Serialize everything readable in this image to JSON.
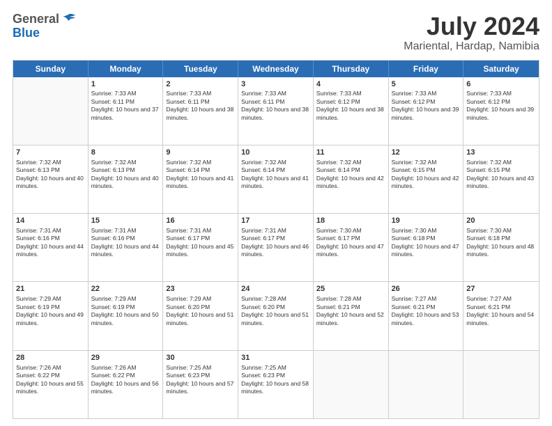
{
  "header": {
    "logo_general": "General",
    "logo_blue": "Blue",
    "title": "July 2024",
    "subtitle": "Mariental, Hardap, Namibia"
  },
  "days": [
    "Sunday",
    "Monday",
    "Tuesday",
    "Wednesday",
    "Thursday",
    "Friday",
    "Saturday"
  ],
  "weeks": [
    [
      {
        "day": "",
        "sunrise": "",
        "sunset": "",
        "daylight": ""
      },
      {
        "day": "1",
        "sunrise": "7:33 AM",
        "sunset": "6:11 PM",
        "daylight": "10 hours and 37 minutes."
      },
      {
        "day": "2",
        "sunrise": "7:33 AM",
        "sunset": "6:11 PM",
        "daylight": "10 hours and 38 minutes."
      },
      {
        "day": "3",
        "sunrise": "7:33 AM",
        "sunset": "6:11 PM",
        "daylight": "10 hours and 38 minutes."
      },
      {
        "day": "4",
        "sunrise": "7:33 AM",
        "sunset": "6:12 PM",
        "daylight": "10 hours and 38 minutes."
      },
      {
        "day": "5",
        "sunrise": "7:33 AM",
        "sunset": "6:12 PM",
        "daylight": "10 hours and 39 minutes."
      },
      {
        "day": "6",
        "sunrise": "7:33 AM",
        "sunset": "6:12 PM",
        "daylight": "10 hours and 39 minutes."
      }
    ],
    [
      {
        "day": "7",
        "sunrise": "7:32 AM",
        "sunset": "6:13 PM",
        "daylight": "10 hours and 40 minutes."
      },
      {
        "day": "8",
        "sunrise": "7:32 AM",
        "sunset": "6:13 PM",
        "daylight": "10 hours and 40 minutes."
      },
      {
        "day": "9",
        "sunrise": "7:32 AM",
        "sunset": "6:14 PM",
        "daylight": "10 hours and 41 minutes."
      },
      {
        "day": "10",
        "sunrise": "7:32 AM",
        "sunset": "6:14 PM",
        "daylight": "10 hours and 41 minutes."
      },
      {
        "day": "11",
        "sunrise": "7:32 AM",
        "sunset": "6:14 PM",
        "daylight": "10 hours and 42 minutes."
      },
      {
        "day": "12",
        "sunrise": "7:32 AM",
        "sunset": "6:15 PM",
        "daylight": "10 hours and 42 minutes."
      },
      {
        "day": "13",
        "sunrise": "7:32 AM",
        "sunset": "6:15 PM",
        "daylight": "10 hours and 43 minutes."
      }
    ],
    [
      {
        "day": "14",
        "sunrise": "7:31 AM",
        "sunset": "6:16 PM",
        "daylight": "10 hours and 44 minutes."
      },
      {
        "day": "15",
        "sunrise": "7:31 AM",
        "sunset": "6:16 PM",
        "daylight": "10 hours and 44 minutes."
      },
      {
        "day": "16",
        "sunrise": "7:31 AM",
        "sunset": "6:17 PM",
        "daylight": "10 hours and 45 minutes."
      },
      {
        "day": "17",
        "sunrise": "7:31 AM",
        "sunset": "6:17 PM",
        "daylight": "10 hours and 46 minutes."
      },
      {
        "day": "18",
        "sunrise": "7:30 AM",
        "sunset": "6:17 PM",
        "daylight": "10 hours and 47 minutes."
      },
      {
        "day": "19",
        "sunrise": "7:30 AM",
        "sunset": "6:18 PM",
        "daylight": "10 hours and 47 minutes."
      },
      {
        "day": "20",
        "sunrise": "7:30 AM",
        "sunset": "6:18 PM",
        "daylight": "10 hours and 48 minutes."
      }
    ],
    [
      {
        "day": "21",
        "sunrise": "7:29 AM",
        "sunset": "6:19 PM",
        "daylight": "10 hours and 49 minutes."
      },
      {
        "day": "22",
        "sunrise": "7:29 AM",
        "sunset": "6:19 PM",
        "daylight": "10 hours and 50 minutes."
      },
      {
        "day": "23",
        "sunrise": "7:29 AM",
        "sunset": "6:20 PM",
        "daylight": "10 hours and 51 minutes."
      },
      {
        "day": "24",
        "sunrise": "7:28 AM",
        "sunset": "6:20 PM",
        "daylight": "10 hours and 51 minutes."
      },
      {
        "day": "25",
        "sunrise": "7:28 AM",
        "sunset": "6:21 PM",
        "daylight": "10 hours and 52 minutes."
      },
      {
        "day": "26",
        "sunrise": "7:27 AM",
        "sunset": "6:21 PM",
        "daylight": "10 hours and 53 minutes."
      },
      {
        "day": "27",
        "sunrise": "7:27 AM",
        "sunset": "6:21 PM",
        "daylight": "10 hours and 54 minutes."
      }
    ],
    [
      {
        "day": "28",
        "sunrise": "7:26 AM",
        "sunset": "6:22 PM",
        "daylight": "10 hours and 55 minutes."
      },
      {
        "day": "29",
        "sunrise": "7:26 AM",
        "sunset": "6:22 PM",
        "daylight": "10 hours and 56 minutes."
      },
      {
        "day": "30",
        "sunrise": "7:25 AM",
        "sunset": "6:23 PM",
        "daylight": "10 hours and 57 minutes."
      },
      {
        "day": "31",
        "sunrise": "7:25 AM",
        "sunset": "6:23 PM",
        "daylight": "10 hours and 58 minutes."
      },
      {
        "day": "",
        "sunrise": "",
        "sunset": "",
        "daylight": ""
      },
      {
        "day": "",
        "sunrise": "",
        "sunset": "",
        "daylight": ""
      },
      {
        "day": "",
        "sunrise": "",
        "sunset": "",
        "daylight": ""
      }
    ]
  ]
}
